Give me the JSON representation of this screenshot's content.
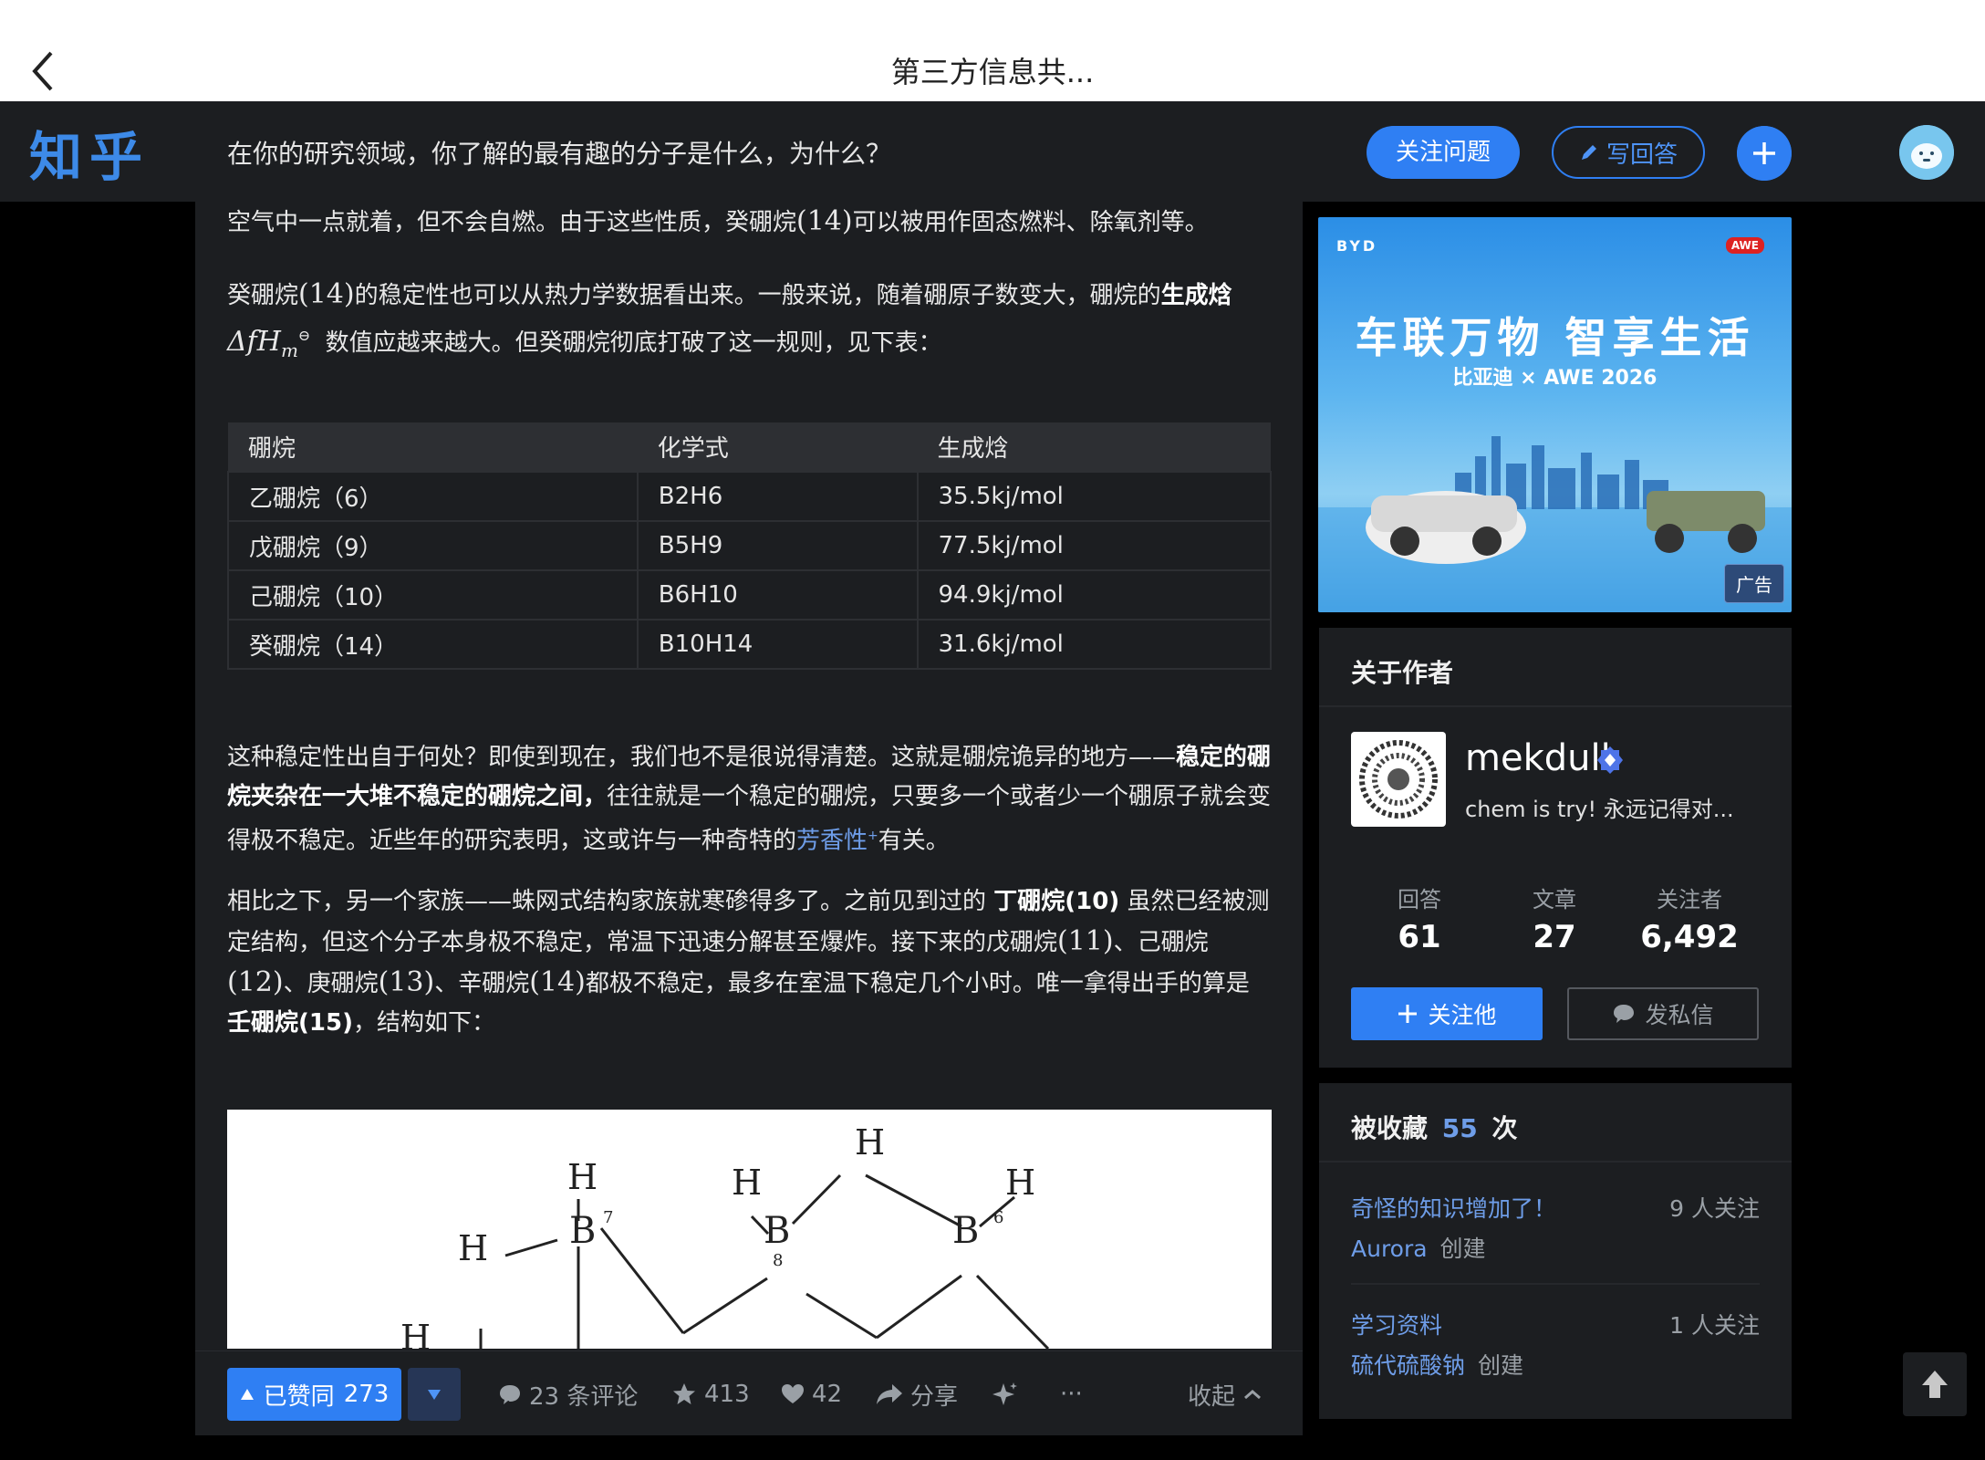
{
  "appbar": {
    "title": "第三方信息共..."
  },
  "header": {
    "logo": "知乎",
    "question": "在你的研究领域，你了解的最有趣的分子是什么，为什么？",
    "follow_question": "关注问题",
    "write_answer": "写回答"
  },
  "article": {
    "p1": "空气中一点就着，但不会自燃。由于这些性质，癸硼烷",
    "p1_num": "(14)",
    "p1_rest": "可以被用作固态燃料、除氧剂等。",
    "p2_a": "癸硼烷",
    "p2_num": "(14)",
    "p2_b": "的稳定性也可以从热力学数据看出来。一般来说，随着硼原子数变大，硼烷的",
    "p2_bold": "生成焓",
    "p2_math_main": "ΔfH",
    "p2_math_sub": "m",
    "p2_math_sup": "⊖",
    "p2_c": "数值应越来越大。但癸硼烷彻底打破了这一规则，见下表：",
    "table": {
      "headers": [
        "硼烷",
        "化学式",
        "生成焓"
      ],
      "rows": [
        [
          "乙硼烷（6）",
          "B2H6",
          "35.5kj/mol"
        ],
        [
          "戊硼烷（9）",
          "B5H9",
          "77.5kj/mol"
        ],
        [
          "己硼烷（10）",
          "B6H10",
          "94.9kj/mol"
        ],
        [
          "癸硼烷（14）",
          "B10H14",
          "31.6kj/mol"
        ]
      ]
    },
    "p3_a": "这种稳定性出自于何处？即使到现在，我们也不是很说得清楚。这就是硼烷诡异的地方——",
    "p3_bold": "稳定的硼烷夹杂在一大堆不稳定的硼烷之间，",
    "p3_b": "往往就是一个稳定的硼烷，只要多一个或者少一个硼原子就会变得极不稳定。近些年的研究表明，这或许与一种奇特的",
    "p3_link": "芳香性",
    "p3_c": "有关。",
    "p4_a": "相比之下，另一个家族——蛛网式结构家族就寒碜得多了。之前见到过的 ",
    "p4_bold1": "丁硼烷(10)",
    "p4_b": " 虽然已经被测定结构，但这个分子本身极不稳定，常温下迅速分解甚至爆炸。接下来的戊硼烷",
    "p4_n11": "(11)",
    "p4_c": "、己硼烷",
    "p4_n12": "(12)",
    "p4_d": "、庚硼烷",
    "p4_n13": "(13)",
    "p4_e": "、辛硼烷",
    "p4_n14": "(14)",
    "p4_f": "都极不稳定，最多在室温下稳定几个小时。唯一拿得出手的算是",
    "p4_bold2": "壬硼烷(15)",
    "p4_g": "，结构如下："
  },
  "structure": {
    "labels": [
      "H",
      "H",
      "H",
      "H",
      "H",
      "H",
      "B",
      "7",
      "B",
      "8",
      "B",
      "6"
    ]
  },
  "actions": {
    "voted": "已赞同",
    "vote_count": "273",
    "comments": "23 条评论",
    "stars": "413",
    "likes": "42",
    "share": "分享",
    "more": "···",
    "collapse": "收起"
  },
  "ad": {
    "headline": "车联万物 智享生活",
    "sub": "比亚迪 × AWE 2026",
    "badge": "广告",
    "brand_left": "BYD",
    "brand_right": "AWE"
  },
  "author": {
    "card_title": "关于作者",
    "name": "mekdull",
    "bio": "chem is try! 永远记得对...",
    "stats": [
      {
        "label": "回答",
        "value": "61"
      },
      {
        "label": "文章",
        "value": "27"
      },
      {
        "label": "关注者",
        "value": "6,492"
      }
    ],
    "follow": "关注他",
    "message": "发私信"
  },
  "favorites": {
    "title_a": "被收藏",
    "count": "55",
    "title_b": "次",
    "items": [
      {
        "name": "奇怪的知识增加了！",
        "followers": "9 人关注",
        "creator": "Aurora",
        "created": "创建"
      },
      {
        "name": "学习资料",
        "followers": "1 人关注",
        "creator": "硫代硫酸钠",
        "created": "创建"
      }
    ]
  }
}
